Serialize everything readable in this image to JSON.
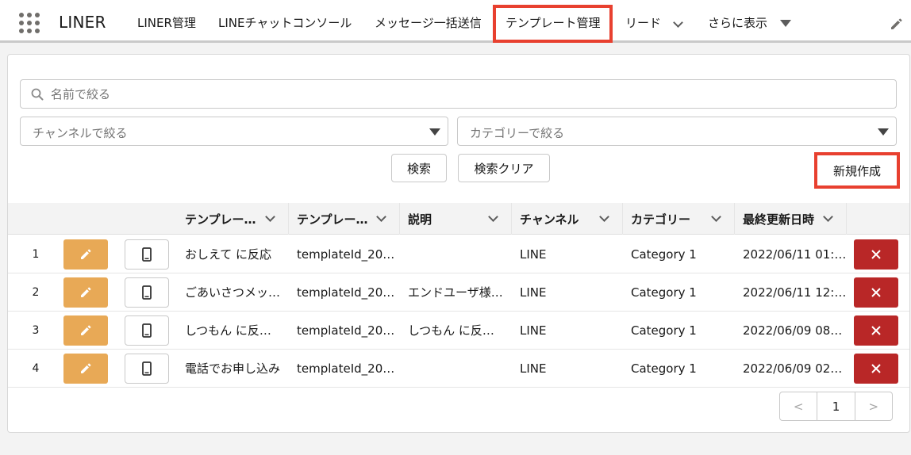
{
  "app": {
    "name": "LINER"
  },
  "nav": {
    "items": [
      {
        "label": "LINER管理"
      },
      {
        "label": "LINEチャットコンソール"
      },
      {
        "label": "メッセージ一括送信"
      },
      {
        "label": "テンプレート管理",
        "active": true
      },
      {
        "label": "リード",
        "has_dropdown": true
      },
      {
        "label": "さらに表示",
        "has_dropdown": true
      }
    ]
  },
  "filters": {
    "name_placeholder": "名前で絞る",
    "channel_placeholder": "チャンネルで絞る",
    "category_placeholder": "カテゴリーで絞る",
    "search_label": "検索",
    "clear_label": "検索クリア",
    "new_label": "新規作成"
  },
  "table": {
    "columns": [
      {
        "label": "テンプレー…"
      },
      {
        "label": "テンプレー…"
      },
      {
        "label": "説明"
      },
      {
        "label": "チャンネル"
      },
      {
        "label": "カテゴリー"
      },
      {
        "label": "最終更新日時"
      }
    ],
    "rows": [
      {
        "num": "1",
        "name": "おしえて に反応",
        "template_id": "templateId_20…",
        "description": "",
        "channel": "LINE",
        "category": "Category 1",
        "updated": "2022/06/11 01:…"
      },
      {
        "num": "2",
        "name": "ごあいさつメッ…",
        "template_id": "templateId_20…",
        "description": "エンドユーザ様…",
        "channel": "LINE",
        "category": "Category 1",
        "updated": "2022/06/11 12:…"
      },
      {
        "num": "3",
        "name": "しつもん に反…",
        "template_id": "templateId_20…",
        "description": "しつもん に反…",
        "channel": "LINE",
        "category": "Category 1",
        "updated": "2022/06/09 08…"
      },
      {
        "num": "4",
        "name": "電話でお申し込み",
        "template_id": "templateId_20…",
        "description": "",
        "channel": "LINE",
        "category": "Category 1",
        "updated": "2022/06/09 02…"
      }
    ]
  },
  "pagination": {
    "prev": "<",
    "current": "1",
    "next": ">"
  },
  "colors": {
    "edit": "#e8a956",
    "delete": "#b92727",
    "highlight": "#e8402f"
  }
}
